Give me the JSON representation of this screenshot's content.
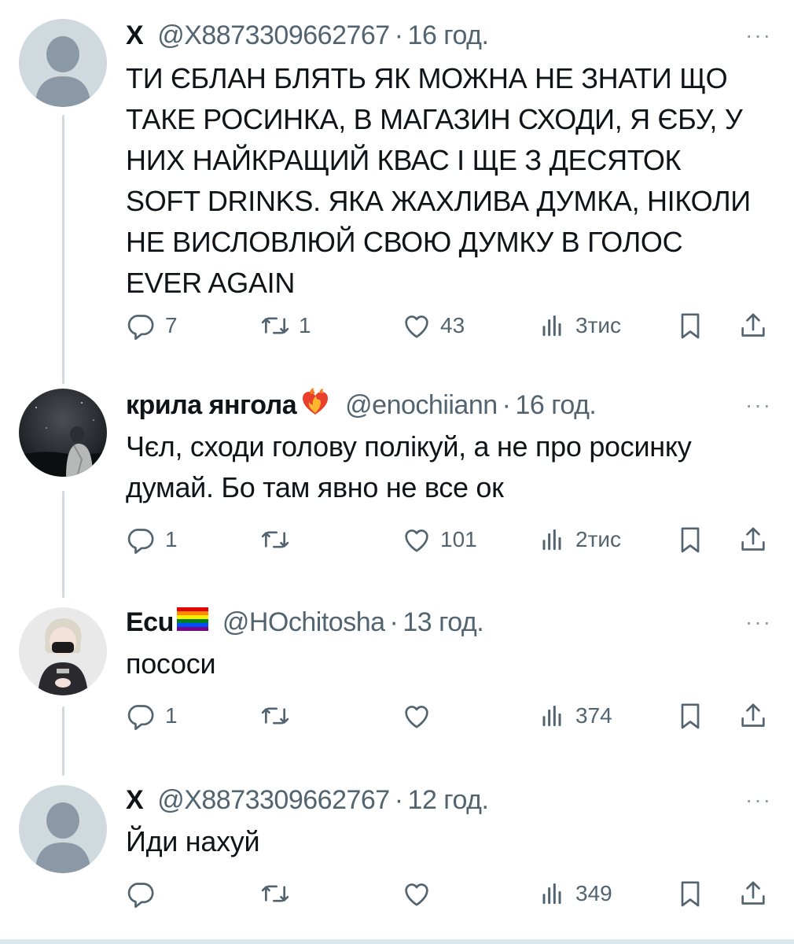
{
  "tweets": [
    {
      "name": "X",
      "handle": "@X8873309662767",
      "separator": "·",
      "time": "16 год.",
      "text": "ТИ ЄБЛАН БЛЯТЬ ЯК МОЖНА НЕ ЗНАТИ ЩО ТАКЕ РОСИНКА, В МАГАЗИН СХОДИ, Я ЄБУ, У НИХ НАЙКРАЩИЙ КВАС І ЩЕ З ДЕСЯТОК SOFT DRINKS. ЯКА ЖАХЛИВА ДУМКА, НІКОЛИ НЕ ВИСЛОВЛЮЙ СВОЮ ДУМКУ В ГОЛОС EVER AGAIN",
      "more": "···",
      "replies": "7",
      "reposts": "1",
      "likes": "43",
      "views": "3тис",
      "avatar": "default-avatar"
    },
    {
      "name": "крила янгола",
      "name_emoji": "heart-on-fire",
      "handle": "@enochiiann",
      "separator": "·",
      "time": "16 год.",
      "text": "Чєл, сходи голову полікуй, а не про росинку думай. Бо там явно не все ок",
      "more": "···",
      "replies": "1",
      "reposts": "",
      "likes": "101",
      "views": "2тис",
      "avatar": "photo-avatar-dark-sky"
    },
    {
      "name": "Ecu",
      "name_emoji": "rainbow-flag",
      "handle": "@HOchitosha",
      "separator": "·",
      "time": "13 год.",
      "text": "пососи",
      "more": "···",
      "replies": "1",
      "reposts": "",
      "likes": "",
      "views": "374",
      "avatar": "photo-avatar-person-mask"
    },
    {
      "name": "X",
      "handle": "@X8873309662767",
      "separator": "·",
      "time": "12 год.",
      "text": "Йди нахуй",
      "more": "···",
      "replies": "",
      "reposts": "",
      "likes": "",
      "views": "349",
      "avatar": "default-avatar"
    }
  ],
  "colors": {
    "text": "#0f1419",
    "secondary": "#536471",
    "thread_line": "#cfd9de",
    "default_avatar_bg": "#cfd9de",
    "default_avatar_fg": "#8b98a5"
  }
}
